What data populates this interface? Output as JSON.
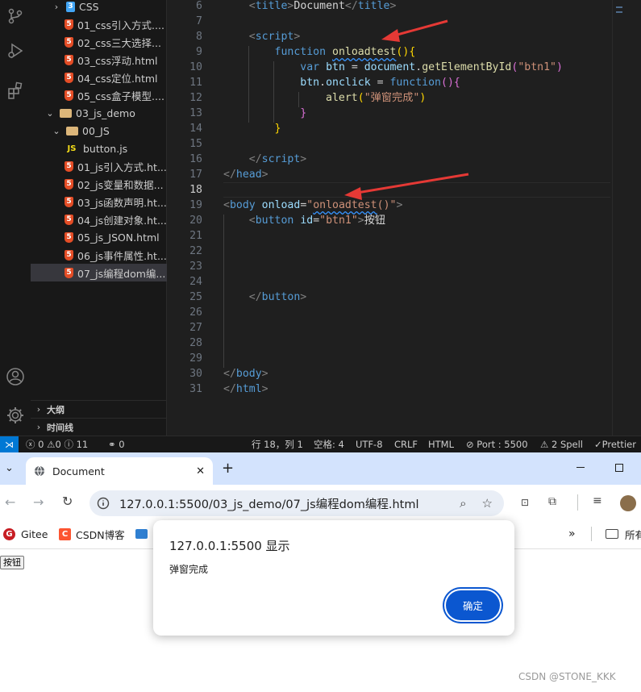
{
  "explorer": {
    "items": [
      {
        "label": "CSS",
        "type": "css-folder",
        "indent": 1,
        "chev": "›"
      },
      {
        "label": "01_css引入方式....",
        "type": "html",
        "indent": 2
      },
      {
        "label": "02_css三大选择...",
        "type": "html",
        "indent": 2
      },
      {
        "label": "03_css浮动.html",
        "type": "html",
        "indent": 2
      },
      {
        "label": "04_css定位.html",
        "type": "html",
        "indent": 2
      },
      {
        "label": "05_css盒子模型....",
        "type": "html",
        "indent": 2
      },
      {
        "label": "03_js_demo",
        "type": "folder",
        "indent": 0,
        "chev": "⌄"
      },
      {
        "label": "00_JS",
        "type": "folder",
        "indent": 1,
        "chev": "⌄"
      },
      {
        "label": "button.js",
        "type": "js",
        "indent": 2
      },
      {
        "label": "01_js引入方式.ht...",
        "type": "html",
        "indent": 2
      },
      {
        "label": "02_js变量和数据...",
        "type": "html",
        "indent": 2
      },
      {
        "label": "03_js函数声明.ht...",
        "type": "html",
        "indent": 2
      },
      {
        "label": "04_js创建对象.ht...",
        "type": "html",
        "indent": 2
      },
      {
        "label": "05_js_JSON.html",
        "type": "html",
        "indent": 2
      },
      {
        "label": "06_js事件属性.ht...",
        "type": "html",
        "indent": 2
      },
      {
        "label": "07_js编程dom编...",
        "type": "html",
        "indent": 2,
        "selected": true
      }
    ],
    "outline_label": "大纲",
    "timeline_label": "时间线"
  },
  "editor": {
    "line_numbers": [
      "6",
      "7",
      "8",
      "9",
      "10",
      "11",
      "12",
      "13",
      "14",
      "15",
      "16",
      "17",
      "18",
      "19",
      "20",
      "21",
      "22",
      "23",
      "24",
      "25",
      "26",
      "27",
      "28",
      "29",
      "30",
      "31"
    ],
    "current_line": "18",
    "html_js_icon": "JS",
    "html_file_icon": "5",
    "css_folder_icon": "3"
  },
  "statusbar": {
    "errors": "0",
    "warnings": "0",
    "infos": "11",
    "ports_count": "0",
    "position": "行 18，列 1",
    "indent": "空格: 4",
    "encoding": "UTF-8",
    "eol": "CRLF",
    "language": "HTML",
    "port": "Port : 5500",
    "spell": "2 Spell",
    "prettier": "Prettier"
  },
  "browser": {
    "tab_title": "Document",
    "url": "127.0.0.1:5500/03_js_demo/07_js编程dom编程.html",
    "bookmarks": [
      "Gitee",
      "CSDN博客"
    ],
    "all_bookmarks": "所有",
    "page_button": "按钮",
    "accent": "#0b57d0"
  },
  "dialog": {
    "title": "127.0.0.1:5500 显示",
    "message": "弹窗完成",
    "ok_label": "确定"
  },
  "watermark": "CSDN @STONE_KKK"
}
